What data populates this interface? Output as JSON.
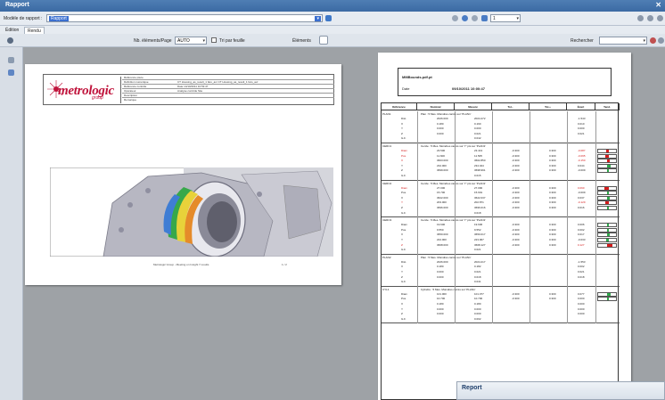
{
  "window": {
    "title": "Rapport",
    "close_icon": "close-icon"
  },
  "toolbar1": {
    "model_label": "Modèle de rapport :",
    "model_value": "Rapport",
    "page_value": "1"
  },
  "tabs": [
    {
      "label": "Édition"
    },
    {
      "label": "Rendu"
    }
  ],
  "toolbar2": {
    "elements_per_page_label": "Nb. éléments/Page",
    "elements_per_page_value": "AUTO",
    "fit_label": "Tri par feuille",
    "elements_label": "Éléments",
    "search_label": "Rechercher"
  },
  "page1": {
    "logo_text": "metrologic",
    "logo_sub": "group",
    "meta": [
      {
        "k": "Référence pièce",
        "v": ""
      },
      {
        "k": "Définition numérique",
        "v": "CT Housing_as_result_1 faro_avr   CT Housing_as_result_1 faro_avr"
      },
      {
        "k": "Référence contrôle",
        "v": "Date   14/10/2011  10:53:47"
      },
      {
        "k": "Opérateur",
        "v": "Analyse contrôle   Site"
      },
      {
        "k": "Description",
        "v": ""
      },
      {
        "k": "Remarque",
        "v": ""
      }
    ],
    "footer": "Metrologic Group - Meeting on Insight 7 results",
    "page_num": "1 / 2"
  },
  "page2": {
    "header_file": "MMBounds.pdf.pt",
    "header_date_label": "Date",
    "header_date": "09/10/2011 10:00:47",
    "columns": [
      "Référence",
      "Nominal",
      "Mesuré",
      "Tol.-",
      "Tol.+",
      "Écart",
      "Tend."
    ],
    "sections": [
      {
        "name": "PLAN1",
        "desc": "Plan : 5 Mes. Moindres carrés sur 'PLAN1'",
        "rows": [
          [
            "Dist.",
            "2026.000",
            "2024.472",
            "",
            "",
            "-1.543",
            false,
            0
          ],
          [
            "X",
            "0.180",
            "0.190",
            "",
            "",
            "0.010",
            false,
            0
          ],
          [
            "Y",
            "0.000",
            "0.000",
            "",
            "",
            "0.000",
            false,
            0
          ],
          [
            "Z",
            "0.000",
            "0.021",
            "",
            "",
            "0.021",
            false,
            0
          ],
          [
            "G.F.",
            "",
            "0.042",
            "",
            "",
            "",
            false,
            0
          ]
        ]
      },
      {
        "name": "CERC1",
        "desc": "Cercle : 5 Mes. Moindres carrés sur 'Y' pts sur 'PLAN1'",
        "rows": [
          [
            "Diam",
            "23.500",
            "23.413",
            "-0.300",
            "0.300",
            "-0.087",
            true,
            0.45
          ],
          [
            "Pos.",
            "11.600",
            "11.505",
            "-0.300",
            "0.300",
            "-0.095",
            true,
            0.4
          ],
          [
            "X",
            "3603.000",
            "3602.850",
            "-0.300",
            "0.300",
            "-0.150",
            true,
            0.55
          ],
          [
            "Y",
            "234.000",
            "234.044",
            "-0.300",
            "0.300",
            "0.044",
            false,
            0.6
          ],
          [
            "Z",
            "3699.000",
            "3698.991",
            "-0.300",
            "0.300",
            "-0.009",
            false,
            0.5
          ],
          [
            "G.F.",
            "",
            "0.015",
            "",
            "",
            "",
            false,
            0
          ]
        ]
      },
      {
        "name": "CERC2",
        "desc": "Cercle : 5 Mes. Moindres carrés sur 'Y' pts sur 'PLAN1'",
        "rows": [
          [
            "Diam",
            "27.000",
            "27.090",
            "-0.300",
            "0.300",
            "0.090",
            true,
            0.35
          ],
          [
            "Pos.",
            "15.700",
            "15.691",
            "-0.300",
            "0.300",
            "-0.009",
            false,
            0.5
          ],
          [
            "X",
            "3622.000",
            "3622.037",
            "-0.300",
            "0.300",
            "0.037",
            false,
            0.55
          ],
          [
            "Y",
            "203.000",
            "202.871",
            "-0.300",
            "0.300",
            "-0.129",
            true,
            0.4
          ],
          [
            "Z",
            "3696.000",
            "3696.016",
            "-0.300",
            "0.300",
            "0.016",
            false,
            0.5
          ],
          [
            "G.F.",
            "",
            "0.018",
            "",
            "",
            "",
            false,
            0
          ]
        ]
      },
      {
        "name": "CERC3",
        "desc": "Cercle : 5 Mes. Moindres carrés sur 'Y' pts sur 'PLAN1'",
        "rows": [
          [
            "Diam",
            "19.600",
            "19.606",
            "-0.300",
            "0.300",
            "0.006",
            false,
            0.5
          ],
          [
            "Pos.",
            "9.550",
            "9.552",
            "-0.300",
            "0.300",
            "0.002",
            false,
            0.5
          ],
          [
            "X",
            "3650.000",
            "3650.017",
            "-0.300",
            "0.300",
            "0.017",
            false,
            0.55
          ],
          [
            "Y",
            "224.000",
            "223.967",
            "-0.300",
            "0.300",
            "-0.033",
            false,
            0.45
          ],
          [
            "Z",
            "3668.000",
            "3668.127",
            "-0.300",
            "0.300",
            "0.127",
            true,
            0.7
          ],
          [
            "G.F.",
            "",
            "0.021",
            "",
            "",
            "",
            false,
            0
          ]
        ]
      },
      {
        "name": "PLAN2",
        "desc": "Plan : 5 Mes. Moindres carrés sur 'PLAN1'",
        "rows": [
          [
            "Dist.",
            "2026.000",
            "2024.217",
            "",
            "",
            "-1.553",
            false,
            0
          ],
          [
            "X",
            "0.180",
            "0.182",
            "",
            "",
            "0.002",
            false,
            0
          ],
          [
            "Y",
            "0.000",
            "0.021",
            "",
            "",
            "0.021",
            false,
            0
          ],
          [
            "Z",
            "0.000",
            "0.018",
            "",
            "",
            "0.018",
            false,
            0
          ],
          [
            "G.F.",
            "",
            "0.041",
            "",
            "",
            "",
            false,
            0
          ]
        ]
      },
      {
        "name": "CYL1",
        "desc": "Cylindre : 5 Mes. Moindres carrés sur 'PLAN1'",
        "rows": [
          [
            "Diam",
            "101.000",
            "101.077",
            "-0.300",
            "0.300",
            "0.077",
            false,
            0.6
          ],
          [
            "Pos.",
            "10.700",
            "10.700",
            "-0.300",
            "0.300",
            "0.000",
            false,
            0.5
          ],
          [
            "X",
            "0.180",
            "0.180",
            "",
            "",
            "0.000",
            false,
            0
          ],
          [
            "Y",
            "0.000",
            "0.000",
            "",
            "",
            "0.000",
            false,
            0
          ],
          [
            "Z",
            "0.000",
            "0.000",
            "",
            "",
            "0.000",
            false,
            0
          ],
          [
            "G.F.",
            "",
            "0.002",
            "",
            "",
            "",
            false,
            0
          ]
        ]
      }
    ]
  },
  "popup": {
    "title": "Report"
  }
}
